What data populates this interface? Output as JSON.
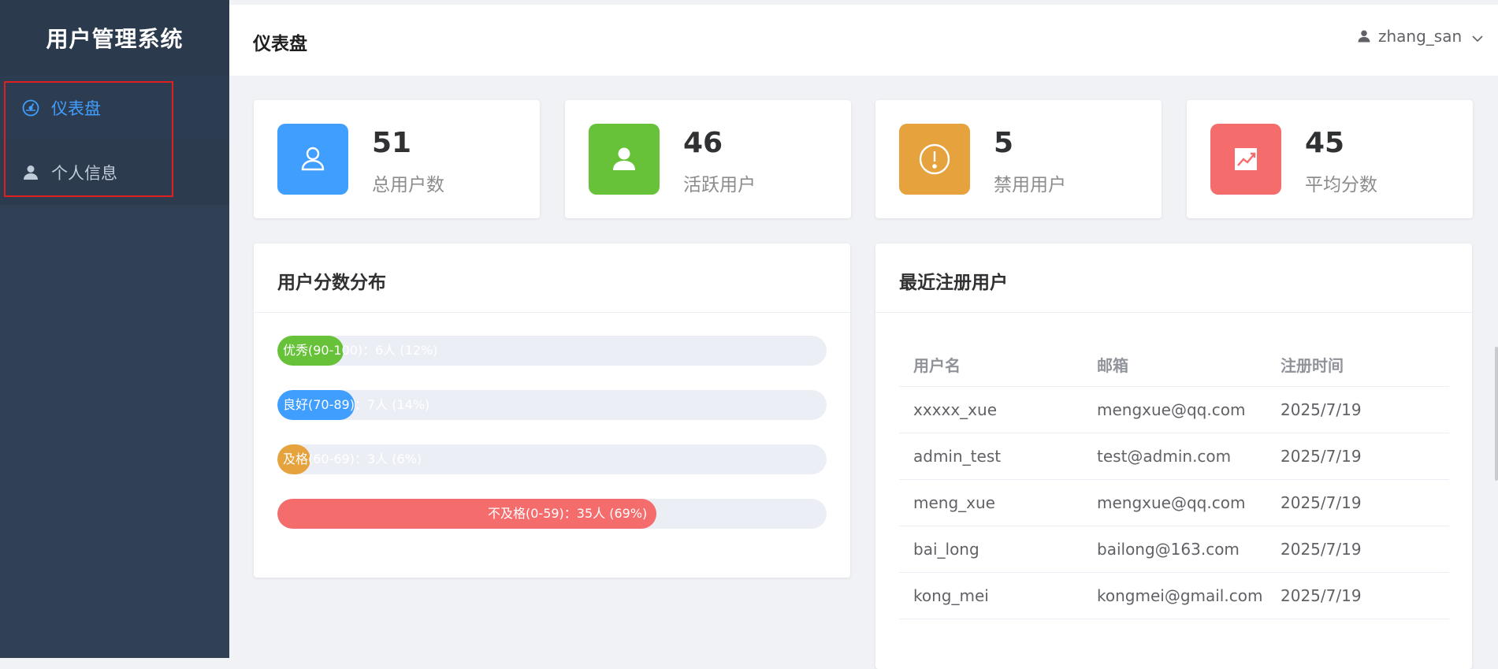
{
  "app": {
    "title": "用户管理系统"
  },
  "sidebar": {
    "items": [
      {
        "label": "仪表盘",
        "icon": "dashboard-icon",
        "active": true
      },
      {
        "label": "个人信息",
        "icon": "user-icon",
        "active": false
      }
    ]
  },
  "header": {
    "title": "仪表盘",
    "username": "zhang_san"
  },
  "stats": [
    {
      "value": "51",
      "label": "总用户数",
      "color": "#409eff",
      "icon": "user-outline-icon"
    },
    {
      "value": "46",
      "label": "活跃用户",
      "color": "#67c23a",
      "icon": "user-filled-icon"
    },
    {
      "value": "5",
      "label": "禁用用户",
      "color": "#e6a23c",
      "icon": "warning-icon"
    },
    {
      "value": "45",
      "label": "平均分数",
      "color": "#f56c6c",
      "icon": "trend-chart-icon"
    }
  ],
  "distribution": {
    "title": "用户分数分布",
    "bars": [
      {
        "label": "优秀(90-100)：6人 (12%)",
        "percent": 12,
        "color": "#67c23a"
      },
      {
        "label": "良好(70-89)：7人 (14%)",
        "percent": 14,
        "color": "#409eff"
      },
      {
        "label": "及格(60-69)：3人 (6%)",
        "percent": 6,
        "color": "#e6a23c"
      },
      {
        "label": "不及格(0-59)：35人 (69%)",
        "percent": 69,
        "color": "#f56c6c"
      }
    ]
  },
  "recent": {
    "title": "最近注册用户",
    "columns": [
      "用户名",
      "邮箱",
      "注册时间"
    ],
    "rows": [
      [
        "xxxxx_xue",
        "mengxue@qq.com",
        "2025/7/19"
      ],
      [
        "admin_test",
        "test@admin.com",
        "2025/7/19"
      ],
      [
        "meng_xue",
        "mengxue@qq.com",
        "2025/7/19"
      ],
      [
        "bai_long",
        "bailong@163.com",
        "2025/7/19"
      ],
      [
        "kong_mei",
        "kongmei@gmail.com",
        "2025/7/19"
      ]
    ]
  }
}
